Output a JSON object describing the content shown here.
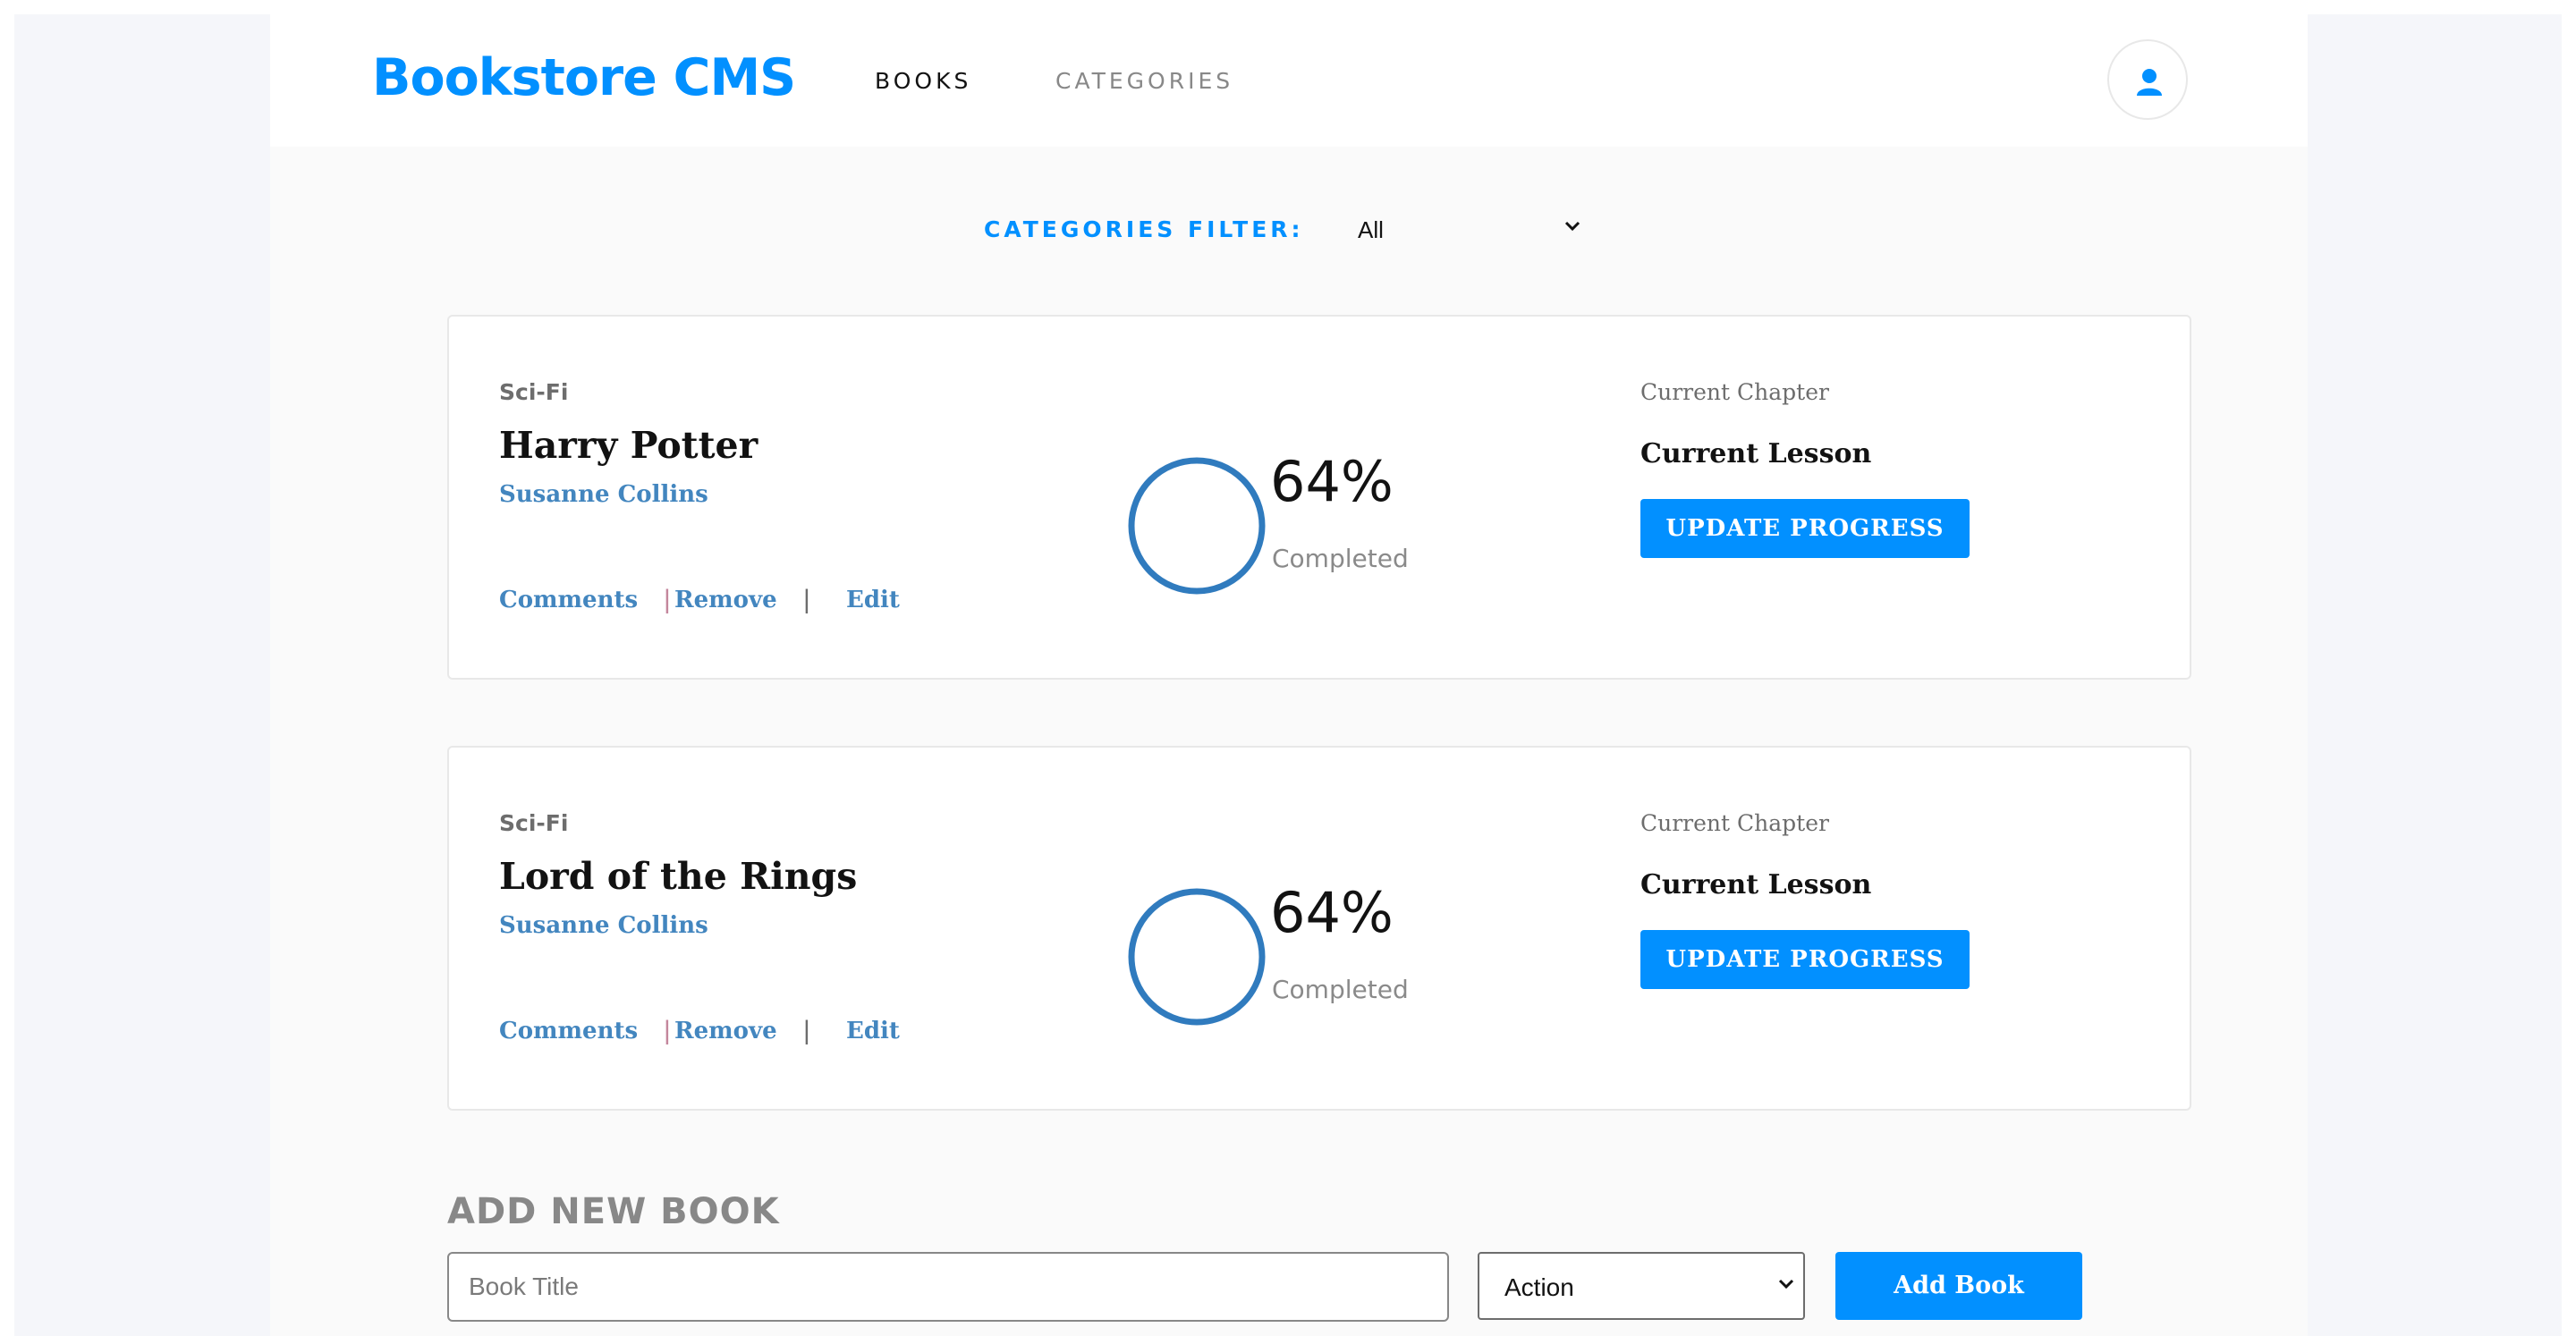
{
  "brand": "Bookstore CMS",
  "nav": {
    "books": "BOOKS",
    "categories": "CATEGORIES"
  },
  "user_icon": "user-icon",
  "filter": {
    "label": "CATEGORIES FILTER:",
    "selected": "All"
  },
  "books": [
    {
      "genre": "Sci-Fi",
      "title": "Harry Potter",
      "author": "Susanne Collins",
      "actions": {
        "comments": "Comments",
        "remove": "Remove",
        "edit": "Edit"
      },
      "progress_text": "64%",
      "progress": 0.64,
      "completed_label": "Completed",
      "chapter_label": "Current Chapter",
      "lesson": "Current Lesson",
      "update_label": "UPDATE PROGRESS"
    },
    {
      "genre": "Sci-Fi",
      "title": "Lord of the Rings",
      "author": "Susanne Collins",
      "actions": {
        "comments": "Comments",
        "remove": "Remove",
        "edit": "Edit"
      },
      "progress_text": "64%",
      "progress": 0.64,
      "completed_label": "Completed",
      "chapter_label": "Current Chapter",
      "lesson": "Current Lesson",
      "update_label": "UPDATE PROGRESS"
    }
  ],
  "add_form": {
    "heading": "ADD NEW BOOK",
    "title_placeholder": "Book Title",
    "category_selected": "Action",
    "submit_label": "Add Book"
  },
  "colors": {
    "accent": "#0290ff",
    "link": "#4386bf",
    "ring": "#307bbe"
  }
}
